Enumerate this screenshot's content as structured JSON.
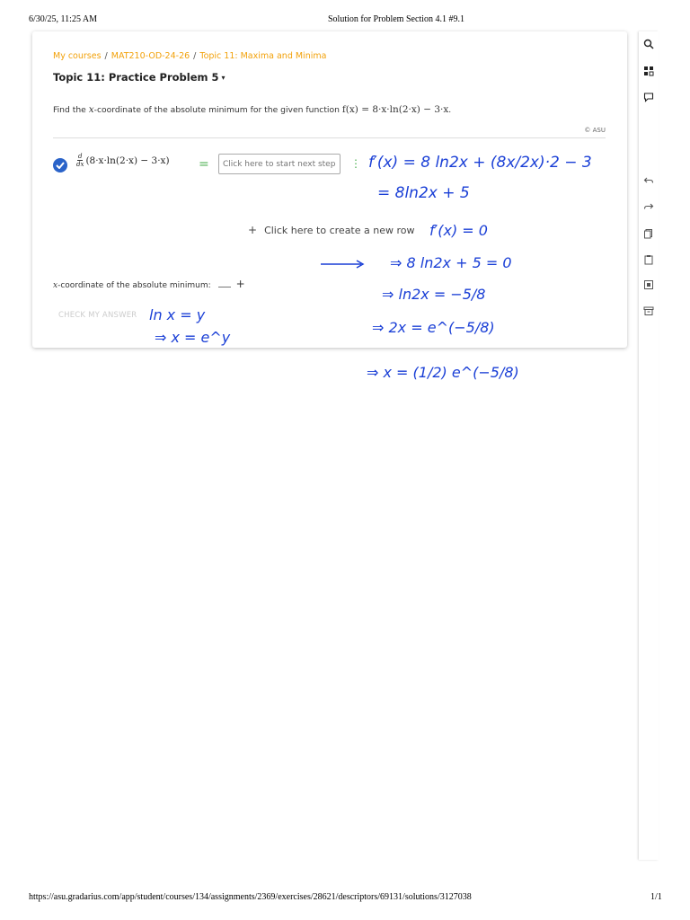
{
  "print_header": {
    "datetime": "6/30/25, 11:25 AM",
    "title": "Solution for Problem Section 4.1 #9.1"
  },
  "print_footer": {
    "url": "https://asu.gradarius.com/app/student/courses/134/assignments/2369/exercises/28621/descriptors/69131/solutions/3127038",
    "page": "1/1"
  },
  "breadcrumb": {
    "items": [
      "My courses",
      "MAT210-OD-24-26",
      "Topic 11: Maxima and Minima"
    ],
    "separator": "/"
  },
  "topic": {
    "title": "Topic 11: Practice Problem 5",
    "caret": "▾"
  },
  "problem": {
    "prefix": "Find the ",
    "var": "x",
    "middle": "-coordinate of the absolute minimum for the given function ",
    "function": "f(x) = 8·x·ln(2·x) − 3·x",
    "suffix": "."
  },
  "copyright": "© ASU",
  "step": {
    "deriv_num": "d",
    "deriv_den": "dx",
    "expression": "(8·x·ln(2·x) − 3·x)",
    "equals": "=",
    "input_placeholder": "Click here to start next step",
    "menu": "⋮"
  },
  "new_row": {
    "plus": "+",
    "label": "Click here to create a new row"
  },
  "answer": {
    "var": "x",
    "label": "-coordinate of the absolute minimum:",
    "plus": "+"
  },
  "check_answer_label": "CHECK MY ANSWER",
  "toolbar": {
    "icons": [
      "search-icon",
      "grid-icon",
      "comment-icon",
      "undo-icon",
      "redo-icon",
      "copy-icon",
      "clipboard-icon",
      "image-icon",
      "archive-icon"
    ]
  },
  "handwriting": {
    "line1": "f′(x) = 8 ln2x + (8x/2x)·2 − 3",
    "line2": "= 8ln2x + 5",
    "line3": "f′(x) = 0",
    "line4": "⇒ 8 ln2x + 5 = 0",
    "line5": "⇒ ln2x = −5/8",
    "line6": "⇒ 2x = e^(−5/8)",
    "line7": "⇒ x = (1/2) e^(−5/8)",
    "side1": "ln x = y",
    "side2": "⇒ x = e^y"
  },
  "colors": {
    "accent": "#f2a10a",
    "check": "#2a63c9",
    "equals": "#4caf50",
    "ink": "#1a3fd6"
  }
}
